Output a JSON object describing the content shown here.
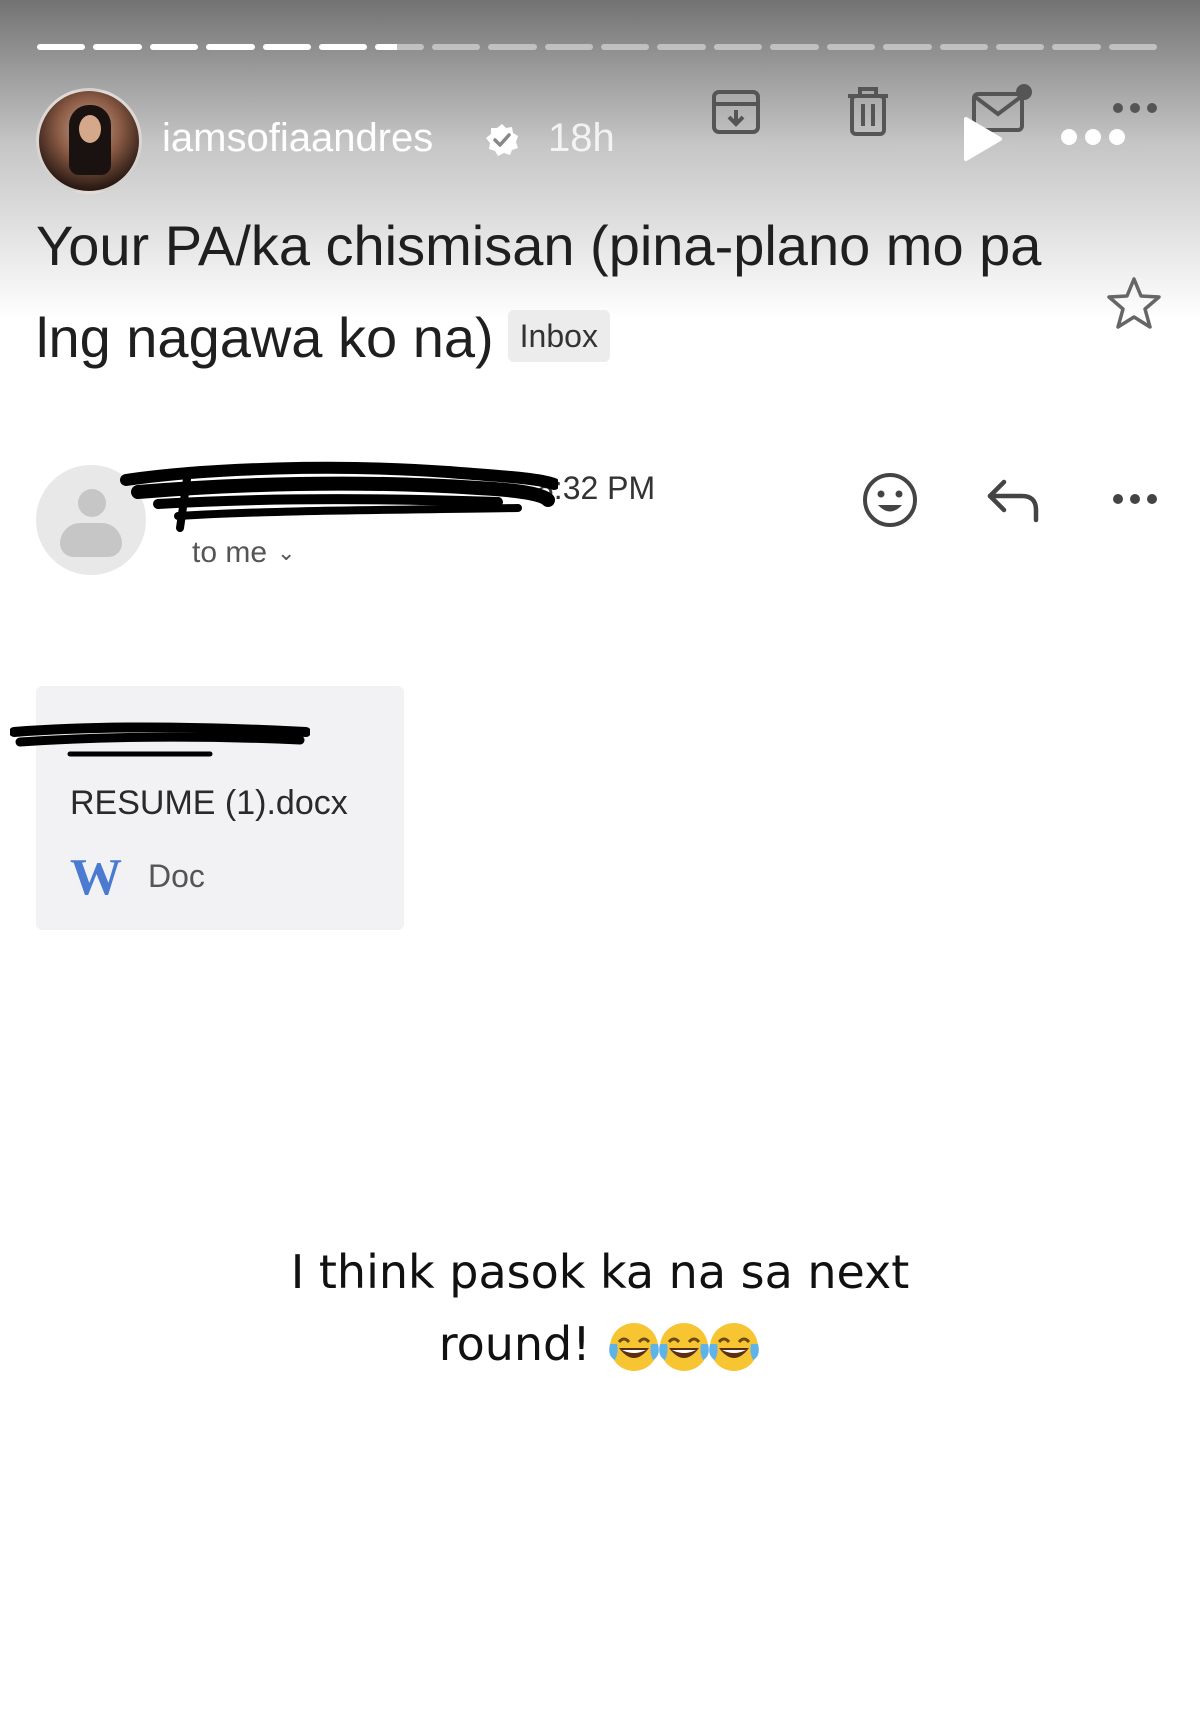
{
  "story": {
    "username": "iamsofiaandres",
    "time": "18h",
    "progress_total_segments": 20,
    "progress_completed_segments": 6,
    "progress_current_fraction": 0.45
  },
  "email": {
    "subject": "Your PA/ka chismisan (pina-plano mo pa lng nagawa ko na)",
    "label": "Inbox",
    "time": "8:32 PM",
    "recipient": "to me",
    "attachment": {
      "name": "RESUME (1).docx",
      "type_letter": "W",
      "type": "Doc"
    }
  },
  "caption": {
    "line1": "I think pasok ka na sa next",
    "line2": "round!"
  },
  "colors": {
    "word_blue": "#4a7bd0",
    "attachment_bg": "#f2f2f4",
    "label_bg": "#ececec"
  }
}
